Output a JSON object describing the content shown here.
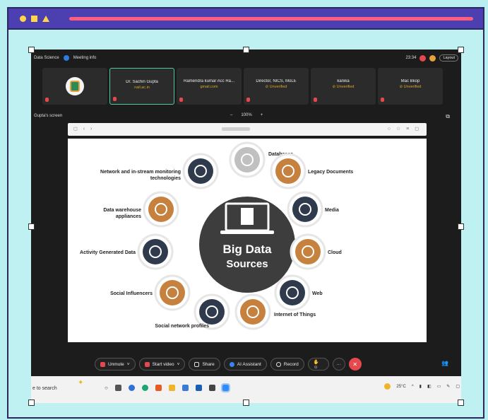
{
  "zoom": {
    "meeting_name": "Data Science",
    "meeting_info": "Meeting info",
    "time": "23:34",
    "layout_label": "Layout",
    "participants": [
      {
        "name": "",
        "sub": "",
        "active": false,
        "avatar": true
      },
      {
        "name": "Dr. Sachin Gupta",
        "sub": "nail.ac.in",
        "active": true
      },
      {
        "name": "Ramendra kumar Acc Ra...",
        "sub": "gmail.com",
        "active": false
      },
      {
        "name": "Director, NICS, MoLE",
        "sub": "⊘ Unverified",
        "active": false
      },
      {
        "name": "kanika",
        "sub": "⊘ Unverified",
        "active": false
      },
      {
        "name": "Mac Bkop",
        "sub": "⊘ Unverified",
        "active": false
      }
    ],
    "share_owner": "Gupta's screen",
    "zoom_minus": "–",
    "zoom_level": "100%",
    "zoom_plus": "+",
    "toolbar": {
      "unmute": "Unmute",
      "start_video": "Start video",
      "share": "Share",
      "ai_assistant": "AI Assistant",
      "record": "Record",
      "more": "···"
    }
  },
  "slide": {
    "center_title_line1": "Big Data",
    "center_title_line2": "Sources",
    "sources": [
      {
        "label": "Databases",
        "color": "#c0c0c0",
        "icon": "database-icon"
      },
      {
        "label": "Legacy Documents",
        "color": "#c6813f",
        "icon": "clipboard-icon"
      },
      {
        "label": "Media",
        "color": "#2f3b4c",
        "icon": "share-icon"
      },
      {
        "label": "Cloud",
        "color": "#c6813f",
        "icon": "cloud-icon"
      },
      {
        "label": "Web",
        "color": "#2f3b4c",
        "icon": "globe-icon"
      },
      {
        "label": "Internet of Things",
        "color": "#c6813f",
        "icon": "iot-icon"
      },
      {
        "label": "Social network profiles",
        "color": "#2f3b4c",
        "icon": "twitter-icon"
      },
      {
        "label": "Social Influencers",
        "color": "#c6813f",
        "icon": "people-icon"
      },
      {
        "label": "Activity Generated Data",
        "color": "#2f3b4c",
        "icon": "checklist-icon"
      },
      {
        "label": "Data warehouse appliances",
        "color": "#c6813f",
        "icon": "server-icon"
      },
      {
        "label": "Network and in-stream monitoring technologies",
        "color": "#2f3b4c",
        "icon": "network-icon"
      }
    ]
  },
  "taskbar": {
    "search_placeholder": "e to search",
    "temperature": "25°C"
  }
}
